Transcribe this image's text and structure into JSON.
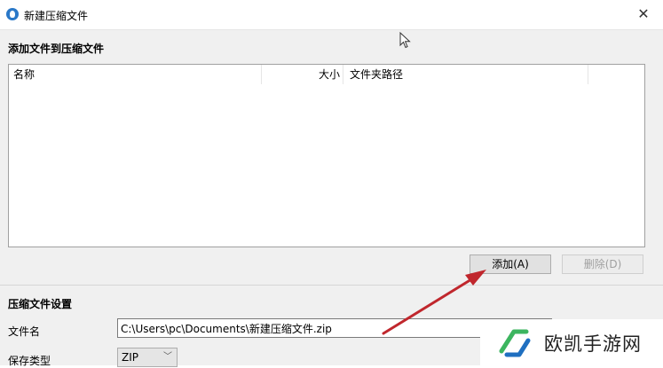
{
  "window": {
    "title": "新建压缩文件",
    "close_glyph": "✕"
  },
  "add_section": {
    "heading": "添加文件到压缩文件",
    "columns": {
      "name": "名称",
      "size": "大小",
      "path": "文件夹路径"
    },
    "buttons": {
      "add": "添加(A)",
      "delete": "删除(D)"
    }
  },
  "settings_section": {
    "heading": "压缩文件设置",
    "filename_label": "文件名",
    "filename_value": "C:\\Users\\pc\\Documents\\新建压缩文件.zip",
    "save_type_label": "保存类型",
    "save_type_value": "ZIP"
  },
  "watermark": {
    "text": "欧凯手游网"
  },
  "colors": {
    "accent_arrow": "#c0272d",
    "brand_logo": "#3cb55f",
    "app_icon": "#2a78c8"
  }
}
